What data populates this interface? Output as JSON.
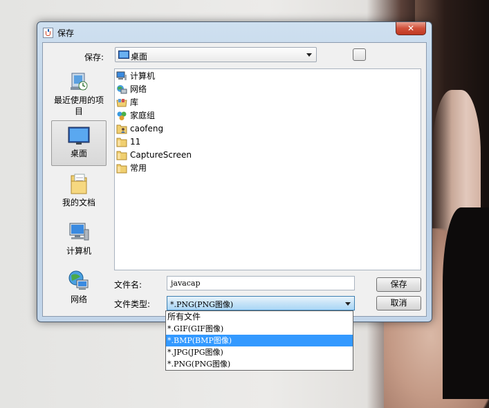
{
  "window": {
    "title": "保存",
    "close_glyph": "✕"
  },
  "save_in": {
    "label": "保存:",
    "value": "桌面",
    "icon": "desktop-icon"
  },
  "places": [
    {
      "label": "最近使用的项目",
      "icon": "recent-items-icon"
    },
    {
      "label": "桌面",
      "icon": "desktop-icon",
      "selected": true
    },
    {
      "label": "我的文档",
      "icon": "documents-folder-icon"
    },
    {
      "label": "计算机",
      "icon": "computer-icon"
    },
    {
      "label": "网络",
      "icon": "network-icon"
    }
  ],
  "files": [
    {
      "name": "计算机",
      "icon": "computer-icon"
    },
    {
      "name": "网络",
      "icon": "network-icon"
    },
    {
      "name": "库",
      "icon": "library-icon"
    },
    {
      "name": "家庭组",
      "icon": "homegroup-icon"
    },
    {
      "name": "caofeng",
      "icon": "user-folder-icon"
    },
    {
      "name": "11",
      "icon": "folder-icon"
    },
    {
      "name": "CaptureScreen",
      "icon": "folder-icon"
    },
    {
      "name": "常用",
      "icon": "folder-icon"
    }
  ],
  "filename": {
    "label": "文件名:",
    "value": "javacap"
  },
  "filetype": {
    "label": "文件类型:",
    "value": "*.PNG(PNG图像)",
    "options": [
      "所有文件",
      "*.GIF(GIF图像)",
      "*.BMP(BMP图像)",
      "*.JPG(JPG图像)",
      "*.PNG(PNG图像)"
    ],
    "highlighted_index": 2
  },
  "buttons": {
    "save": "保存",
    "cancel": "取消"
  },
  "colors": {
    "highlight": "#3399ff",
    "close": "#c7432b"
  }
}
